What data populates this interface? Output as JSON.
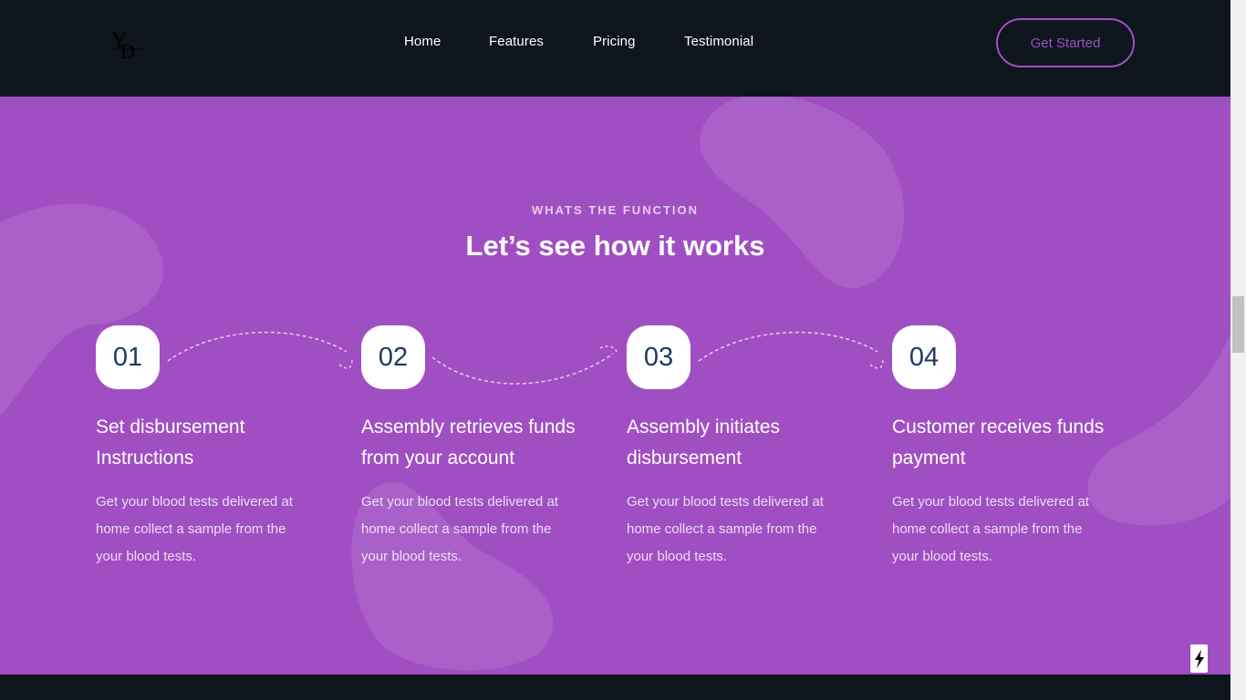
{
  "header": {
    "logo_icon": "yd-monogram-logo",
    "nav": [
      {
        "label": "Home"
      },
      {
        "label": "Features"
      },
      {
        "label": "Pricing"
      },
      {
        "label": "Testimonial"
      }
    ],
    "cta_label": "Get Started"
  },
  "section": {
    "eyebrow": "WHATS THE FUNCTION",
    "title": "Let’s see how it works",
    "steps": [
      {
        "number": "01",
        "title_lines": [
          "Set disbursement",
          "Instructions"
        ],
        "desc_lines": [
          "Get your blood tests delivered at",
          "home collect a sample from the",
          "your blood tests."
        ]
      },
      {
        "number": "02",
        "title_lines": [
          "Assembly retrieves funds",
          "from your account"
        ],
        "desc_lines": [
          "Get your blood tests delivered at",
          "home collect a sample from the",
          "your blood tests."
        ]
      },
      {
        "number": "03",
        "title_lines": [
          "Assembly initiates",
          "disbursement"
        ],
        "desc_lines": [
          "Get your blood tests delivered at",
          "home collect a sample from the",
          "your blood tests."
        ]
      },
      {
        "number": "04",
        "title_lines": [
          "Customer receives funds",
          "payment"
        ],
        "desc_lines": [
          "Get your blood tests delivered at",
          "home collect a sample from the",
          "your blood tests."
        ]
      }
    ]
  },
  "colors": {
    "header_bg": "#0e151d",
    "section_bg": "#a04fc3",
    "accent": "#a04fc3",
    "badge_text": "#1e3a64"
  },
  "widgets": {
    "floating_button_icon": "lightning-bolt-icon"
  }
}
